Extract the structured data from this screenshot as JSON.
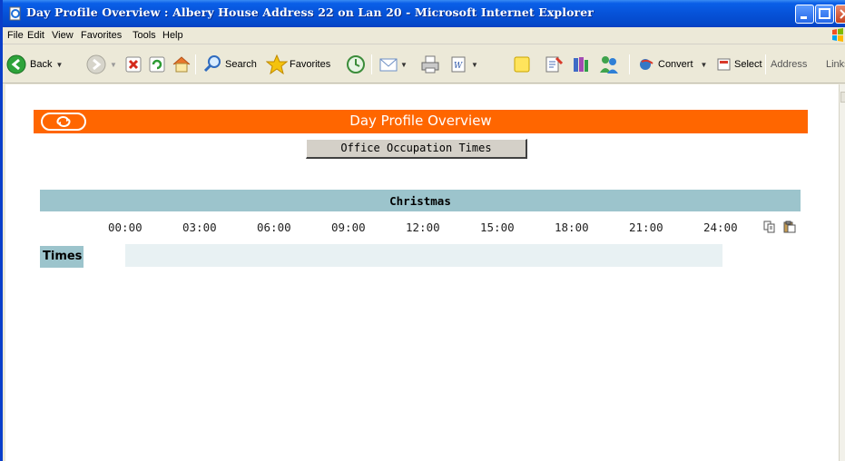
{
  "window": {
    "title": "Day Profile Overview : Albery House Address 22 on Lan 20 - Microsoft Internet Explorer"
  },
  "menu": {
    "items": [
      "File",
      "Edit",
      "View",
      "Favorites",
      "Tools",
      "Help"
    ]
  },
  "toolbar": {
    "back_label": "Back",
    "search_label": "Search",
    "favorites_label": "Favorites",
    "convert_label": "Convert",
    "select_label": "Select",
    "address_label": "Address",
    "links_label": "Links"
  },
  "page": {
    "header_title": "Day Profile Overview",
    "occupation_button": "Office Occupation Times",
    "day_title": "Christmas",
    "hours": [
      "00:00",
      "03:00",
      "06:00",
      "09:00",
      "12:00",
      "15:00",
      "18:00",
      "21:00",
      "24:00"
    ],
    "times_label": "Times"
  },
  "colors": {
    "header_bg": "#ff6600",
    "day_bar_bg": "#9cc4cc",
    "times_track_bg": "#e8f1f3"
  }
}
